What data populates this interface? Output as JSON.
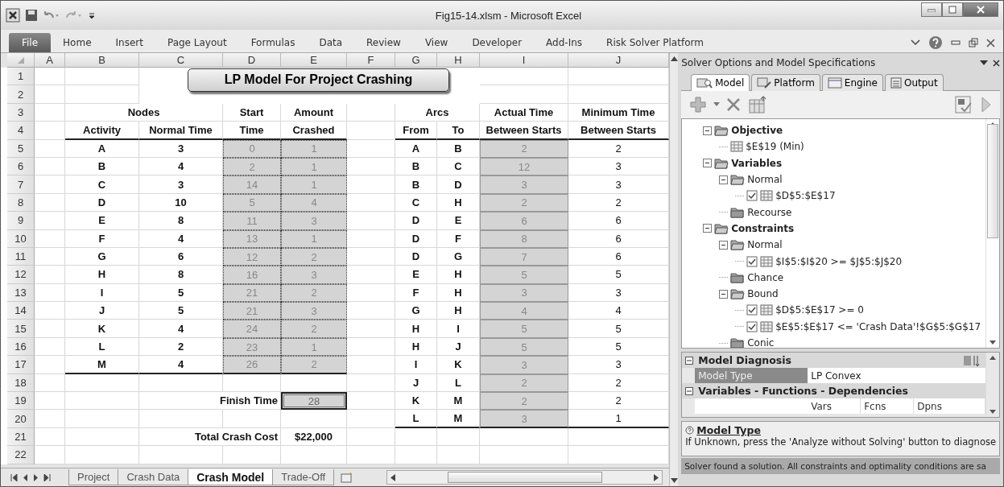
{
  "window": {
    "title": "Fig15-14.xlsm  -  Microsoft Excel"
  },
  "ribbon": {
    "tabs": [
      {
        "label": "File",
        "selected": true
      },
      {
        "label": "Home",
        "selected": false
      },
      {
        "label": "Insert",
        "selected": false
      },
      {
        "label": "Page Layout",
        "selected": false
      },
      {
        "label": "Formulas",
        "selected": false
      },
      {
        "label": "Data",
        "selected": false
      },
      {
        "label": "Review",
        "selected": false
      },
      {
        "label": "View",
        "selected": false
      },
      {
        "label": "Developer",
        "selected": false
      },
      {
        "label": "Add-Ins",
        "selected": false
      },
      {
        "label": "Risk Solver Platform",
        "selected": false
      }
    ]
  },
  "sheet": {
    "columns": [
      "A",
      "B",
      "C",
      "D",
      "E",
      "F",
      "G",
      "H",
      "I",
      "J"
    ],
    "title_box": "LP Model For Project Crashing",
    "rows": [
      {
        "n": "1",
        "cells": []
      },
      {
        "n": "2",
        "cells": []
      },
      {
        "n": "3",
        "cells": [
          "",
          {
            "v": "Nodes",
            "kind": "head-wide"
          },
          "",
          {
            "v": "Start",
            "kind": "head"
          },
          {
            "v": "Amount",
            "kind": "head"
          },
          "",
          {
            "v": "Arcs",
            "kind": "head-wide"
          },
          "",
          {
            "v": "Actual Time",
            "kind": "head"
          },
          {
            "v": "Minimum Time",
            "kind": "head"
          }
        ]
      },
      {
        "n": "4",
        "cells": [
          "",
          {
            "v": "Activity",
            "kind": "head",
            "rule": true
          },
          {
            "v": "Normal Time",
            "kind": "head",
            "rule": true
          },
          {
            "v": "Time",
            "kind": "head",
            "rule": true
          },
          {
            "v": "Crashed",
            "kind": "head",
            "rule": true
          },
          "",
          {
            "v": "From",
            "kind": "head",
            "rule": true
          },
          {
            "v": "To",
            "kind": "head",
            "rule": true
          },
          {
            "v": "Between Starts",
            "kind": "head",
            "rule": true
          },
          {
            "v": "Between Starts",
            "kind": "head",
            "rule": true
          }
        ]
      },
      {
        "n": "5",
        "cells": [
          "",
          {
            "v": "A",
            "kind": "bold"
          },
          {
            "v": "3",
            "kind": "bold"
          },
          {
            "v": "0",
            "kind": "input"
          },
          {
            "v": "1",
            "kind": "input"
          },
          "",
          {
            "v": "A",
            "kind": "bold"
          },
          {
            "v": "B",
            "kind": "bold"
          },
          {
            "v": "2",
            "kind": "calc"
          },
          {
            "v": "2",
            "kind": "plain"
          }
        ]
      },
      {
        "n": "6",
        "cells": [
          "",
          {
            "v": "B",
            "kind": "bold"
          },
          {
            "v": "4",
            "kind": "bold"
          },
          {
            "v": "2",
            "kind": "input"
          },
          {
            "v": "1",
            "kind": "input"
          },
          "",
          {
            "v": "B",
            "kind": "bold"
          },
          {
            "v": "C",
            "kind": "bold"
          },
          {
            "v": "12",
            "kind": "calc"
          },
          {
            "v": "3",
            "kind": "plain"
          }
        ]
      },
      {
        "n": "7",
        "cells": [
          "",
          {
            "v": "C",
            "kind": "bold"
          },
          {
            "v": "3",
            "kind": "bold"
          },
          {
            "v": "14",
            "kind": "input"
          },
          {
            "v": "1",
            "kind": "input"
          },
          "",
          {
            "v": "B",
            "kind": "bold"
          },
          {
            "v": "D",
            "kind": "bold"
          },
          {
            "v": "3",
            "kind": "calc"
          },
          {
            "v": "3",
            "kind": "plain"
          }
        ]
      },
      {
        "n": "8",
        "cells": [
          "",
          {
            "v": "D",
            "kind": "bold"
          },
          {
            "v": "10",
            "kind": "bold"
          },
          {
            "v": "5",
            "kind": "input"
          },
          {
            "v": "4",
            "kind": "input"
          },
          "",
          {
            "v": "C",
            "kind": "bold"
          },
          {
            "v": "H",
            "kind": "bold"
          },
          {
            "v": "2",
            "kind": "calc"
          },
          {
            "v": "2",
            "kind": "plain"
          }
        ]
      },
      {
        "n": "9",
        "cells": [
          "",
          {
            "v": "E",
            "kind": "bold"
          },
          {
            "v": "8",
            "kind": "bold"
          },
          {
            "v": "11",
            "kind": "input"
          },
          {
            "v": "3",
            "kind": "input"
          },
          "",
          {
            "v": "D",
            "kind": "bold"
          },
          {
            "v": "E",
            "kind": "bold"
          },
          {
            "v": "6",
            "kind": "calc"
          },
          {
            "v": "6",
            "kind": "plain"
          }
        ]
      },
      {
        "n": "10",
        "cells": [
          "",
          {
            "v": "F",
            "kind": "bold"
          },
          {
            "v": "4",
            "kind": "bold"
          },
          {
            "v": "13",
            "kind": "input"
          },
          {
            "v": "1",
            "kind": "input"
          },
          "",
          {
            "v": "D",
            "kind": "bold"
          },
          {
            "v": "F",
            "kind": "bold"
          },
          {
            "v": "8",
            "kind": "calc"
          },
          {
            "v": "6",
            "kind": "plain"
          }
        ]
      },
      {
        "n": "11",
        "cells": [
          "",
          {
            "v": "G",
            "kind": "bold"
          },
          {
            "v": "6",
            "kind": "bold"
          },
          {
            "v": "12",
            "kind": "input"
          },
          {
            "v": "2",
            "kind": "input"
          },
          "",
          {
            "v": "D",
            "kind": "bold"
          },
          {
            "v": "G",
            "kind": "bold"
          },
          {
            "v": "7",
            "kind": "calc"
          },
          {
            "v": "6",
            "kind": "plain"
          }
        ]
      },
      {
        "n": "12",
        "cells": [
          "",
          {
            "v": "H",
            "kind": "bold"
          },
          {
            "v": "8",
            "kind": "bold"
          },
          {
            "v": "16",
            "kind": "input"
          },
          {
            "v": "3",
            "kind": "input"
          },
          "",
          {
            "v": "E",
            "kind": "bold"
          },
          {
            "v": "H",
            "kind": "bold"
          },
          {
            "v": "5",
            "kind": "calc"
          },
          {
            "v": "5",
            "kind": "plain"
          }
        ]
      },
      {
        "n": "13",
        "cells": [
          "",
          {
            "v": "I",
            "kind": "bold"
          },
          {
            "v": "5",
            "kind": "bold"
          },
          {
            "v": "21",
            "kind": "input"
          },
          {
            "v": "2",
            "kind": "input"
          },
          "",
          {
            "v": "F",
            "kind": "bold"
          },
          {
            "v": "H",
            "kind": "bold"
          },
          {
            "v": "3",
            "kind": "calc"
          },
          {
            "v": "3",
            "kind": "plain"
          }
        ]
      },
      {
        "n": "14",
        "cells": [
          "",
          {
            "v": "J",
            "kind": "bold"
          },
          {
            "v": "5",
            "kind": "bold"
          },
          {
            "v": "21",
            "kind": "input"
          },
          {
            "v": "3",
            "kind": "input"
          },
          "",
          {
            "v": "G",
            "kind": "bold"
          },
          {
            "v": "H",
            "kind": "bold"
          },
          {
            "v": "4",
            "kind": "calc"
          },
          {
            "v": "4",
            "kind": "plain"
          }
        ]
      },
      {
        "n": "15",
        "cells": [
          "",
          {
            "v": "K",
            "kind": "bold"
          },
          {
            "v": "4",
            "kind": "bold"
          },
          {
            "v": "24",
            "kind": "input"
          },
          {
            "v": "2",
            "kind": "input"
          },
          "",
          {
            "v": "H",
            "kind": "bold"
          },
          {
            "v": "I",
            "kind": "bold"
          },
          {
            "v": "5",
            "kind": "calc"
          },
          {
            "v": "5",
            "kind": "plain"
          }
        ]
      },
      {
        "n": "16",
        "cells": [
          "",
          {
            "v": "L",
            "kind": "bold"
          },
          {
            "v": "2",
            "kind": "bold"
          },
          {
            "v": "23",
            "kind": "input"
          },
          {
            "v": "1",
            "kind": "input"
          },
          "",
          {
            "v": "H",
            "kind": "bold"
          },
          {
            "v": "J",
            "kind": "bold"
          },
          {
            "v": "5",
            "kind": "calc"
          },
          {
            "v": "5",
            "kind": "plain"
          }
        ]
      },
      {
        "n": "17",
        "cells": [
          "",
          {
            "v": "M",
            "kind": "bold",
            "rule": true
          },
          {
            "v": "4",
            "kind": "bold",
            "rule": true
          },
          {
            "v": "26",
            "kind": "input",
            "rule": true
          },
          {
            "v": "2",
            "kind": "input",
            "rule": true
          },
          "",
          {
            "v": "I",
            "kind": "bold"
          },
          {
            "v": "K",
            "kind": "bold"
          },
          {
            "v": "3",
            "kind": "calc"
          },
          {
            "v": "3",
            "kind": "plain"
          }
        ]
      },
      {
        "n": "18",
        "cells": [
          "",
          "",
          "",
          "",
          "",
          "",
          {
            "v": "J",
            "kind": "bold"
          },
          {
            "v": "L",
            "kind": "bold"
          },
          {
            "v": "2",
            "kind": "calc"
          },
          {
            "v": "2",
            "kind": "plain"
          }
        ]
      },
      {
        "n": "19",
        "cells": [
          "",
          "",
          {
            "v": "Finish Time",
            "kind": "label-wide"
          },
          "",
          {
            "v": "28",
            "kind": "target"
          },
          "",
          {
            "v": "K",
            "kind": "bold"
          },
          {
            "v": "M",
            "kind": "bold"
          },
          {
            "v": "2",
            "kind": "calc"
          },
          {
            "v": "2",
            "kind": "plain"
          }
        ]
      },
      {
        "n": "20",
        "cells": [
          "",
          "",
          "",
          "",
          "",
          "",
          {
            "v": "L",
            "kind": "bold",
            "rule": true
          },
          {
            "v": "M",
            "kind": "bold",
            "rule": true
          },
          {
            "v": "3",
            "kind": "calc",
            "rule": true
          },
          {
            "v": "1",
            "kind": "plain",
            "rule": true
          }
        ]
      },
      {
        "n": "21",
        "cells": [
          "",
          "",
          {
            "v": "Total Crash Cost",
            "kind": "label-wide"
          },
          "",
          {
            "v": "$22,000",
            "kind": "bold"
          }
        ]
      },
      {
        "n": "22",
        "cells": []
      }
    ],
    "sheet_tabs": [
      {
        "label": "Project",
        "selected": false
      },
      {
        "label": "Crash Data",
        "selected": false
      },
      {
        "label": "Crash Model",
        "selected": true
      },
      {
        "label": "Trade-Off",
        "selected": false
      }
    ]
  },
  "solver_pane": {
    "title": "Solver Options and Model Specifications",
    "tabs": [
      {
        "label": "Model",
        "selected": true
      },
      {
        "label": "Platform",
        "selected": false
      },
      {
        "label": "Engine",
        "selected": false
      },
      {
        "label": "Output",
        "selected": false
      }
    ],
    "tree": [
      {
        "label": "Objective",
        "kind": "folder",
        "expanded": true,
        "children": [
          {
            "label": "$E$19 (Min)",
            "kind": "objective"
          }
        ]
      },
      {
        "label": "Variables",
        "kind": "folder",
        "expanded": true,
        "children": [
          {
            "label": "Normal",
            "kind": "folder",
            "expanded": true,
            "children": [
              {
                "label": "$D$5:$E$17",
                "kind": "range",
                "checked": true
              }
            ]
          },
          {
            "label": "Recourse",
            "kind": "folder",
            "expanded": false
          }
        ]
      },
      {
        "label": "Constraints",
        "kind": "folder",
        "expanded": true,
        "children": [
          {
            "label": "Normal",
            "kind": "folder",
            "expanded": true,
            "children": [
              {
                "label": "$I$5:$I$20 >= $J$5:$J$20",
                "kind": "range",
                "checked": true
              }
            ]
          },
          {
            "label": "Chance",
            "kind": "folder",
            "expanded": false
          },
          {
            "label": "Bound",
            "kind": "folder",
            "expanded": true,
            "children": [
              {
                "label": "$D$5:$E$17 >= 0",
                "kind": "range",
                "checked": true
              },
              {
                "label": "$E$5:$E$17 <= 'Crash Data'!$G$5:$G$17",
                "kind": "range",
                "checked": true
              }
            ]
          },
          {
            "label": "Conic",
            "kind": "folder",
            "expanded": false
          }
        ]
      }
    ],
    "properties": [
      {
        "title": "Model Diagnosis",
        "expanded": true,
        "rows": [
          {
            "name": "Model Type",
            "value": "LP Convex",
            "selected": true
          }
        ]
      },
      {
        "title": "Variables - Functions - Dependencies",
        "expanded": true,
        "header": [
          "Vars",
          "Fcns",
          "Dpns"
        ]
      }
    ],
    "help": {
      "title": "Model Type",
      "text": "If Unknown, press the 'Analyze without Solving' button to diagnose"
    },
    "status": "Solver found a solution.  All constraints and optimality conditions are sa"
  }
}
